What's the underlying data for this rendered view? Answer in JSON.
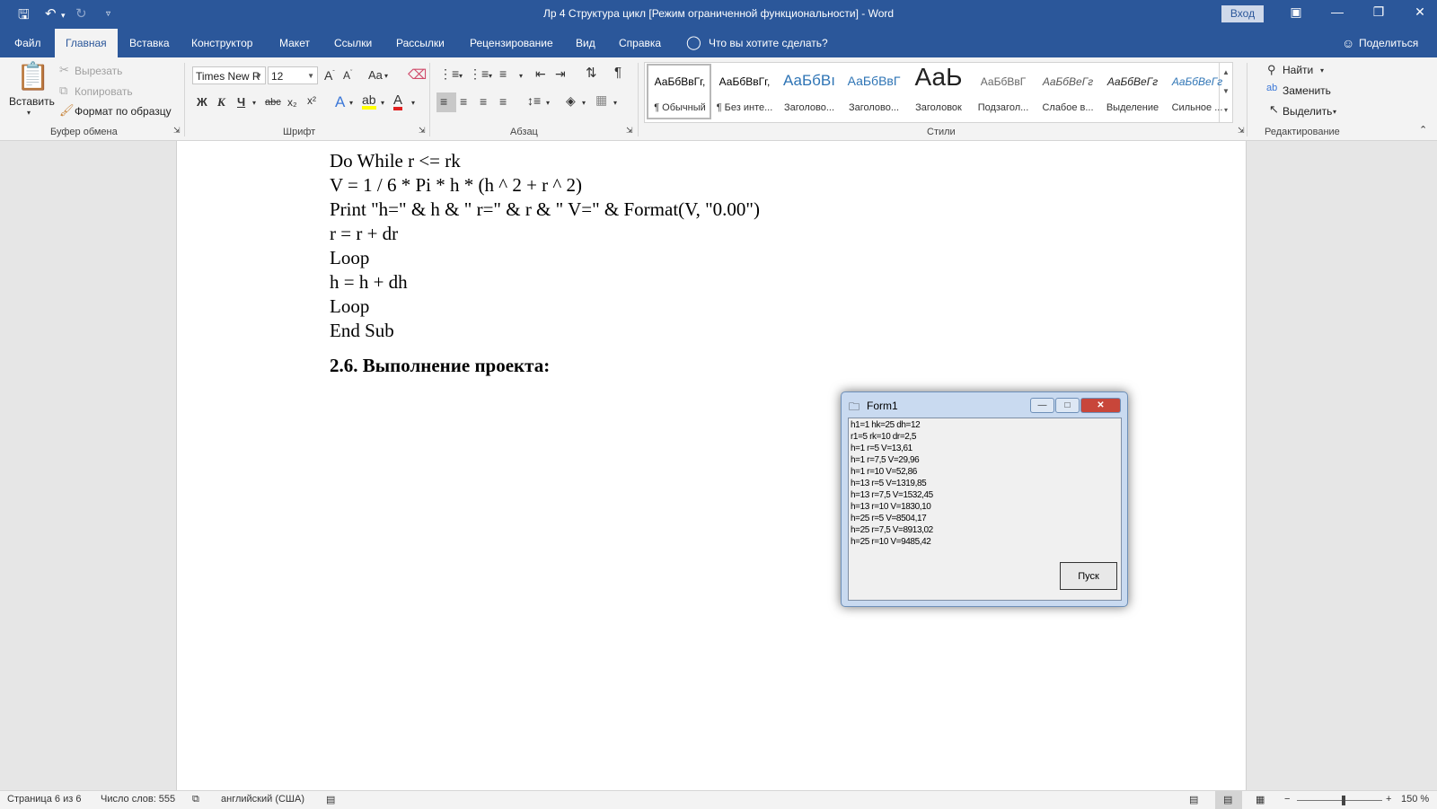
{
  "window": {
    "title": "Лр 4 Структура цикл [Режим ограниченной функциональности]  -  Word",
    "signin": "Вход"
  },
  "tabs": [
    "Файл",
    "Главная",
    "Вставка",
    "Конструктор",
    "Макет",
    "Ссылки",
    "Рассылки",
    "Рецензирование",
    "Вид",
    "Справка"
  ],
  "tellme": "Что вы хотите сделать?",
  "share": "Поделиться",
  "clipboard": {
    "paste": "Вставить",
    "cut": "Вырезать",
    "copy": "Копировать",
    "format_painter": "Формат по образцу",
    "label": "Буфер обмена"
  },
  "font": {
    "name": "Times New R",
    "size": "12",
    "label": "Шрифт",
    "case": "Aa",
    "bold": "Ж",
    "italic": "К",
    "underline": "Ч",
    "strike": "abc",
    "sub": "x₂",
    "sup": "x²"
  },
  "paragraph": {
    "label": "Абзац"
  },
  "styles": {
    "label": "Стили",
    "items": [
      {
        "preview": "АаБбВвГг,",
        "name": "¶ Обычный"
      },
      {
        "preview": "АаБбВвГг,",
        "name": "¶ Без инте..."
      },
      {
        "preview": "АаБбВı",
        "name": "Заголово..."
      },
      {
        "preview": "АаБбВвГ",
        "name": "Заголово..."
      },
      {
        "preview": "АаЬ",
        "name": "Заголовок"
      },
      {
        "preview": "АаБбВвГ",
        "name": "Подзагол..."
      },
      {
        "preview": "АаБбВеГг",
        "name": "Слабое в..."
      },
      {
        "preview": "АаБбВеГг",
        "name": "Выделение"
      },
      {
        "preview": "АаБбВеГг",
        "name": "Сильное ..."
      }
    ]
  },
  "editing": {
    "find": "Найти",
    "replace": "Заменить",
    "select": "Выделить",
    "label": "Редактирование"
  },
  "document": {
    "code_lines": [
      "Do While r <= rk",
      "V = 1 / 6 * Pi * h * (h ^ 2 + r ^ 2)",
      "Print \"h=\" & h & \" r=\" & r & \" V=\" & Format(V, \"0.00\")",
      "r = r + dr",
      "Loop",
      "h = h + dh",
      "Loop",
      "End Sub"
    ],
    "heading": "2.6. Выполнение проекта:"
  },
  "form1": {
    "title": "Form1",
    "output": [
      "h1=1 hk=25 dh=12",
      "r1=5 rk=10 dr=2,5",
      "h=1 r=5 V=13,61",
      "h=1 r=7,5 V=29,96",
      "h=1 r=10 V=52,86",
      "h=13 r=5 V=1319,85",
      "h=13 r=7,5 V=1532,45",
      "h=13 r=10 V=1830,10",
      "h=25 r=5 V=8504,17",
      "h=25 r=7,5 V=8913,02",
      "h=25 r=10 V=9485,42"
    ],
    "button": "Пуск"
  },
  "statusbar": {
    "page": "Страница 6 из 6",
    "words": "Число слов: 555",
    "language": "английский (США)",
    "zoom": "150 %"
  }
}
